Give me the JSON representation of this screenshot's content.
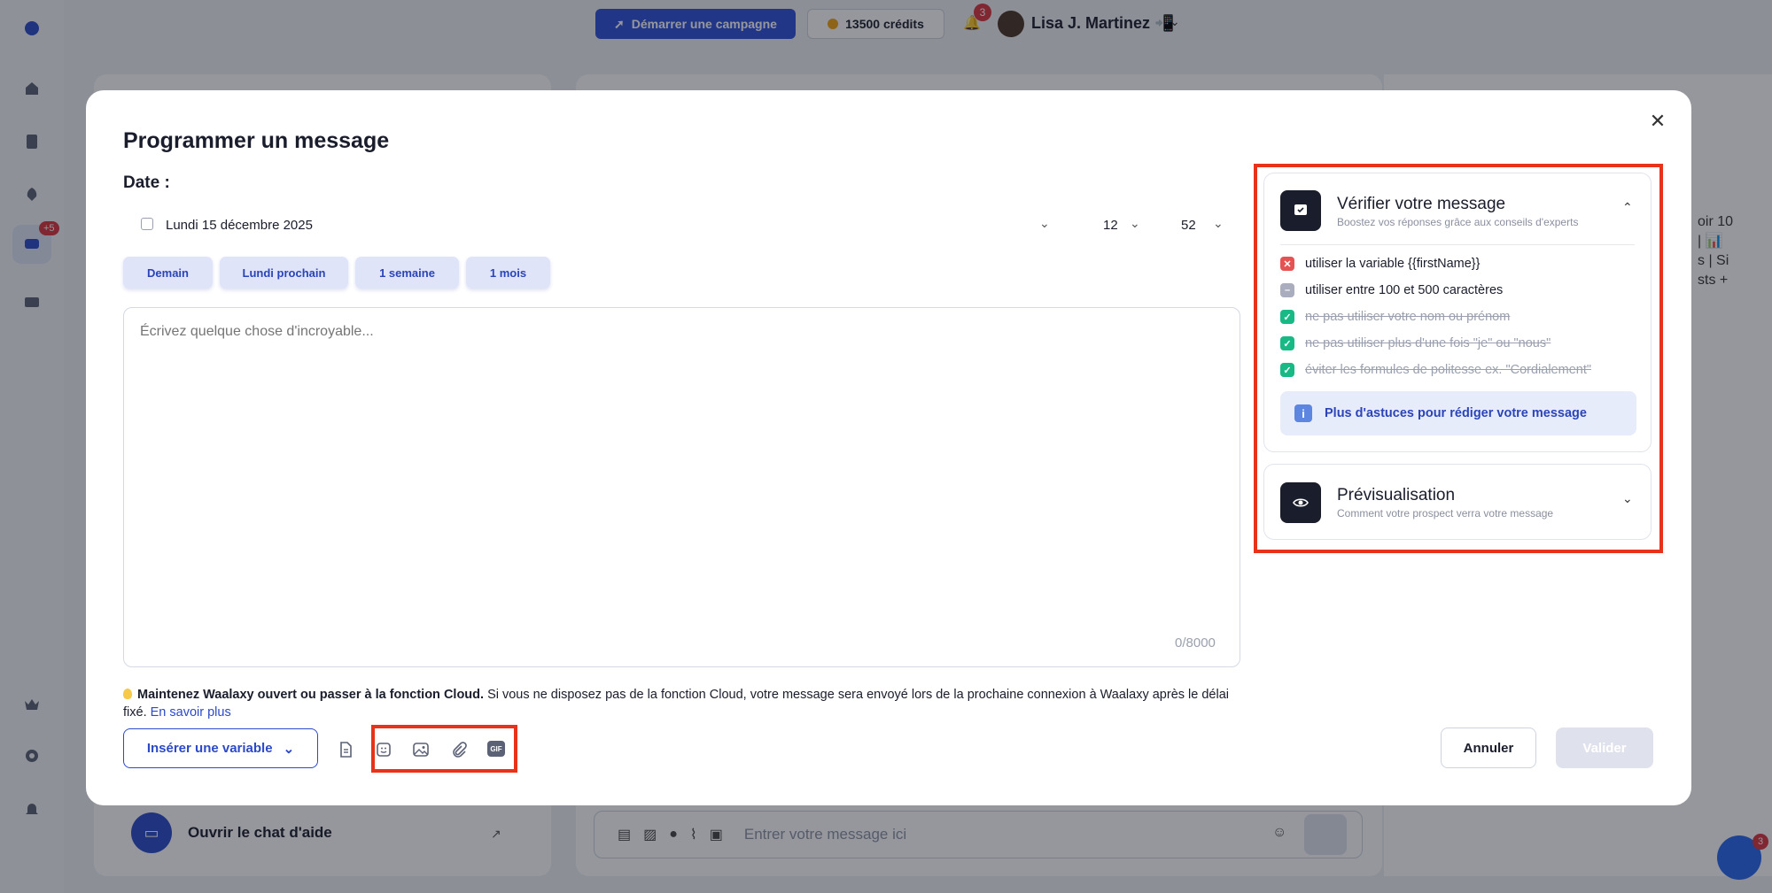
{
  "topbar": {
    "campaign_label": "Démarrer une campagne",
    "credits_label": "13500 crédits",
    "notifications_count": "3",
    "user_name": "Lisa J. Martinez",
    "user_emoji": "📲"
  },
  "sidebar": {
    "messages_badge": "+5"
  },
  "background": {
    "help_chat_label": "Ouvrir le chat d'aide",
    "compose_placeholder": "Entrer votre message ici",
    "right_text": "oir 10\n| 📊\ns | Si\nsts +",
    "intercom_badge": "3"
  },
  "modal": {
    "title": "Programmer un message",
    "date_label": "Date :",
    "date_value": "Lundi 15 décembre 2025",
    "hour_value": "12",
    "minute_value": "52",
    "quick_dates": [
      "Demain",
      "Lundi prochain",
      "1 semaine",
      "1 mois"
    ],
    "message_placeholder": "Écrivez quelque chose d'incroyable...",
    "char_count": "0/8000",
    "notice_bold": "Maintenez Waalaxy ouvert ou passer à la fonction Cloud.",
    "notice_text": " Si vous ne disposez pas de la fonction Cloud, votre message sera envoyé lors de la prochaine connexion à Waalaxy après le délai fixé. ",
    "notice_link": "En savoir plus",
    "insert_variable_label": "Insérer une variable",
    "gif_label": "GIF",
    "cancel_label": "Annuler",
    "validate_label": "Valider"
  },
  "check_card": {
    "title": "Vérifier votre message",
    "subtitle": "Boostez vos réponses grâce aux conseils d'experts",
    "items": [
      {
        "label": "utiliser la variable {{firstName}}",
        "state": "fail"
      },
      {
        "label": "utiliser entre 100 et 500 caractères",
        "state": "neutral"
      },
      {
        "label": "ne pas utiliser votre nom ou prénom",
        "state": "ok"
      },
      {
        "label": "ne pas utiliser plus d'une fois \"je\" ou \"nous\"",
        "state": "ok"
      },
      {
        "label": "éviter les formules de politesse ex. \"Cordialement\"",
        "state": "ok"
      }
    ],
    "tips_label": "Plus d'astuces pour rédiger votre message"
  },
  "preview_card": {
    "title": "Prévisualisation",
    "subtitle": "Comment votre prospect verra votre message"
  },
  "colors": {
    "primary": "#2b49c9",
    "highlight": "#e8321a",
    "success": "#19b986",
    "error": "#e55252"
  }
}
